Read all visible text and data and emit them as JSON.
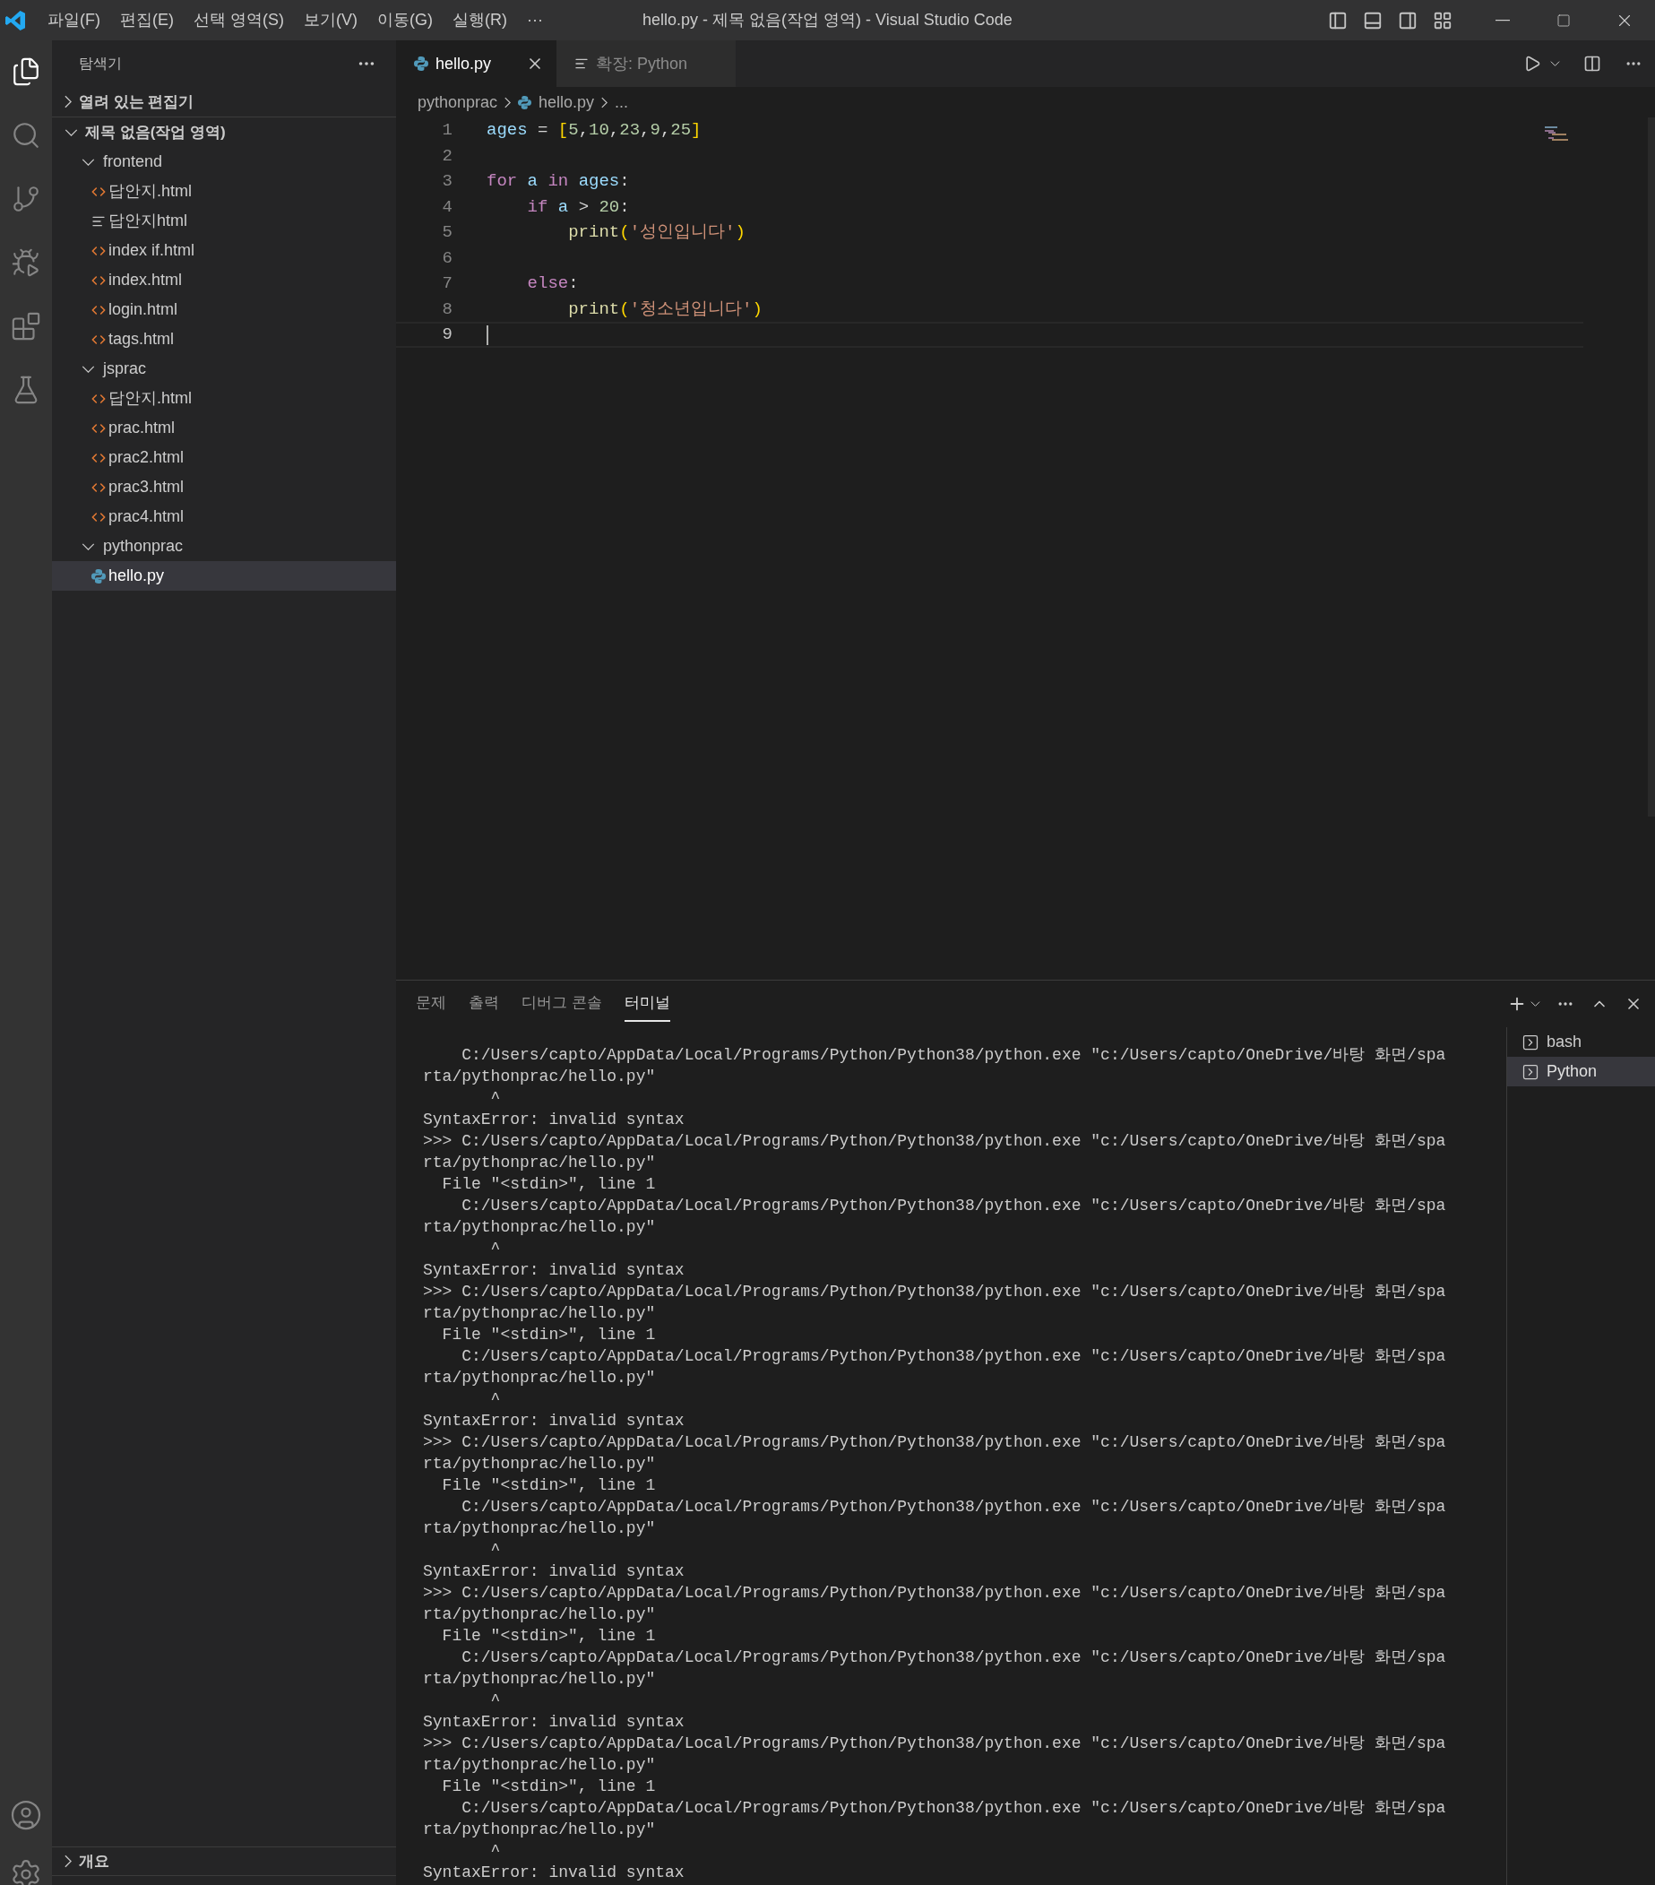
{
  "title_bar": {
    "menus": [
      "파일(F)",
      "편집(E)",
      "선택 영역(S)",
      "보기(V)",
      "이동(G)",
      "실행(R)",
      "···"
    ],
    "title": "hello.py - 제목 없음(작업 영역) - Visual Studio Code"
  },
  "sidebar": {
    "title": "탐색기",
    "sections": [
      {
        "label": "열려 있는 편집기",
        "expanded": false
      },
      {
        "label": "제목 없음(작업 영역)",
        "expanded": true,
        "tree": [
          {
            "label": "frontend",
            "kind": "folder",
            "expanded": true,
            "selected": false,
            "children": [
              {
                "label": "답안지.html",
                "kind": "html",
                "selected": false
              },
              {
                "label": "답안지html",
                "kind": "text",
                "selected": false
              },
              {
                "label": "index if.html",
                "kind": "html",
                "selected": false
              },
              {
                "label": "index.html",
                "kind": "html",
                "selected": false
              },
              {
                "label": "login.html",
                "kind": "html",
                "selected": false
              },
              {
                "label": "tags.html",
                "kind": "html",
                "selected": false
              }
            ]
          },
          {
            "label": "jsprac",
            "kind": "folder",
            "expanded": true,
            "selected": false,
            "children": [
              {
                "label": "답안지.html",
                "kind": "html",
                "selected": false
              },
              {
                "label": "prac.html",
                "kind": "html",
                "selected": false
              },
              {
                "label": "prac2.html",
                "kind": "html",
                "selected": false
              },
              {
                "label": "prac3.html",
                "kind": "html",
                "selected": false
              },
              {
                "label": "prac4.html",
                "kind": "html",
                "selected": false
              }
            ]
          },
          {
            "label": "pythonprac",
            "kind": "folder",
            "expanded": true,
            "selected": false,
            "children": [
              {
                "label": "hello.py",
                "kind": "python",
                "selected": true
              }
            ]
          }
        ]
      }
    ],
    "outline": {
      "label": "개요",
      "expanded": false
    }
  },
  "editor": {
    "tabs": [
      {
        "label": "hello.py",
        "kind": "python",
        "selected": true
      },
      {
        "label": "확장: Python",
        "kind": "text",
        "selected": false
      }
    ],
    "breadcrumbs": [
      {
        "label": "pythonprac",
        "kind": "folder"
      },
      {
        "label": "hello.py",
        "kind": "python"
      },
      {
        "label": "...",
        "kind": "symbol"
      }
    ],
    "lines": [
      {
        "number": "1",
        "current": false,
        "tokens": [
          {
            "kind": "var",
            "text": "ages"
          },
          {
            "kind": "plain",
            "text": " = "
          },
          {
            "kind": "br",
            "text": "["
          },
          {
            "kind": "num",
            "text": "5"
          },
          {
            "kind": "plain",
            "text": ","
          },
          {
            "kind": "num",
            "text": "10"
          },
          {
            "kind": "plain",
            "text": ","
          },
          {
            "kind": "num",
            "text": "23"
          },
          {
            "kind": "plain",
            "text": ","
          },
          {
            "kind": "num",
            "text": "9"
          },
          {
            "kind": "plain",
            "text": ","
          },
          {
            "kind": "num",
            "text": "25"
          },
          {
            "kind": "br",
            "text": "]"
          }
        ]
      },
      {
        "number": "2",
        "current": false
      },
      {
        "number": "3",
        "current": false,
        "tokens": [
          {
            "kind": "kw",
            "text": "for"
          },
          {
            "kind": "var",
            "text": " a"
          },
          {
            "kind": "kw",
            "text": " in"
          },
          {
            "kind": "var",
            "text": " ages"
          },
          {
            "kind": "plain",
            "text": ":"
          }
        ]
      },
      {
        "number": "4",
        "current": false,
        "tokens": [
          {
            "kind": "kw",
            "text": "    if"
          },
          {
            "kind": "var",
            "text": " a"
          },
          {
            "kind": "plain",
            "text": " > "
          },
          {
            "kind": "num",
            "text": "20"
          },
          {
            "kind": "plain",
            "text": ":"
          }
        ]
      },
      {
        "number": "5",
        "current": false,
        "tokens": [
          {
            "kind": "fn",
            "text": "        print"
          },
          {
            "kind": "br",
            "text": "("
          },
          {
            "kind": "str",
            "text": "'성인입니다'"
          },
          {
            "kind": "br",
            "text": ")"
          }
        ]
      },
      {
        "number": "6",
        "current": false
      },
      {
        "number": "7",
        "current": false,
        "tokens": [
          {
            "kind": "kw",
            "text": "    else"
          },
          {
            "kind": "plain",
            "text": ":"
          }
        ]
      },
      {
        "number": "8",
        "current": false,
        "tokens": [
          {
            "kind": "fn",
            "text": "        print"
          },
          {
            "kind": "br",
            "text": "("
          },
          {
            "kind": "str",
            "text": "'청소년입니다'"
          },
          {
            "kind": "br",
            "text": ")"
          }
        ]
      },
      {
        "number": "9",
        "current": true
      }
    ]
  },
  "panel": {
    "tabs": [
      {
        "label": "문제",
        "selected": false
      },
      {
        "label": "출력",
        "selected": false
      },
      {
        "label": "디버그 콘솔",
        "selected": false
      },
      {
        "label": "터미널",
        "selected": true
      }
    ],
    "terminal_lines": [
      "    C:/Users/capto/AppData/Local/Programs/Python/Python38/python.exe \"c:/Users/capto/OneDrive/바탕 화면/spa",
      "rta/pythonprac/hello.py\"",
      "       ^",
      "SyntaxError: invalid syntax",
      ">>> C:/Users/capto/AppData/Local/Programs/Python/Python38/python.exe \"c:/Users/capto/OneDrive/바탕 화면/spa",
      "rta/pythonprac/hello.py\"",
      "  File \"<stdin>\", line 1",
      "    C:/Users/capto/AppData/Local/Programs/Python/Python38/python.exe \"c:/Users/capto/OneDrive/바탕 화면/spa",
      "rta/pythonprac/hello.py\"",
      "       ^",
      "SyntaxError: invalid syntax",
      ">>> C:/Users/capto/AppData/Local/Programs/Python/Python38/python.exe \"c:/Users/capto/OneDrive/바탕 화면/spa",
      "rta/pythonprac/hello.py\"",
      "  File \"<stdin>\", line 1",
      "    C:/Users/capto/AppData/Local/Programs/Python/Python38/python.exe \"c:/Users/capto/OneDrive/바탕 화면/spa",
      "rta/pythonprac/hello.py\"",
      "       ^",
      "SyntaxError: invalid syntax",
      ">>> C:/Users/capto/AppData/Local/Programs/Python/Python38/python.exe \"c:/Users/capto/OneDrive/바탕 화면/spa",
      "rta/pythonprac/hello.py\"",
      "  File \"<stdin>\", line 1",
      "    C:/Users/capto/AppData/Local/Programs/Python/Python38/python.exe \"c:/Users/capto/OneDrive/바탕 화면/spa",
      "rta/pythonprac/hello.py\"",
      "       ^",
      "SyntaxError: invalid syntax",
      ">>> C:/Users/capto/AppData/Local/Programs/Python/Python38/python.exe \"c:/Users/capto/OneDrive/바탕 화면/spa",
      "rta/pythonprac/hello.py\"",
      "  File \"<stdin>\", line 1",
      "    C:/Users/capto/AppData/Local/Programs/Python/Python38/python.exe \"c:/Users/capto/OneDrive/바탕 화면/spa",
      "rta/pythonprac/hello.py\"",
      "       ^",
      "SyntaxError: invalid syntax",
      ">>> C:/Users/capto/AppData/Local/Programs/Python/Python38/python.exe \"c:/Users/capto/OneDrive/바탕 화면/spa",
      "rta/pythonprac/hello.py\"",
      "  File \"<stdin>\", line 1",
      "    C:/Users/capto/AppData/Local/Programs/Python/Python38/python.exe \"c:/Users/capto/OneDrive/바탕 화면/spa",
      "rta/pythonprac/hello.py\"",
      "       ^",
      "SyntaxError: invalid syntax"
    ],
    "terminals": [
      {
        "label": "bash",
        "selected": false
      },
      {
        "label": "Python",
        "selected": true
      }
    ]
  }
}
